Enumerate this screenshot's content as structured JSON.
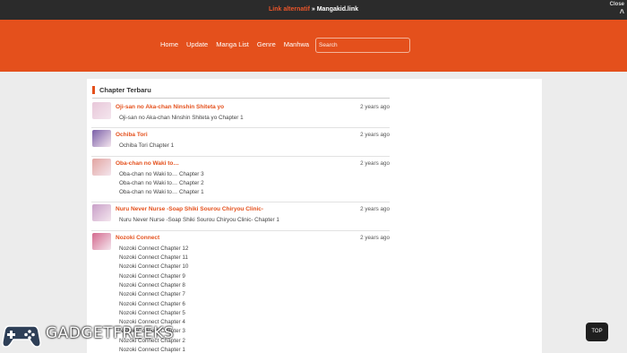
{
  "topbar": {
    "alt_label": "Link alternatif",
    "sep": " » ",
    "site": "Mangakid.link",
    "close_label": "Close",
    "close_icon": "chevron-up-icon"
  },
  "nav": [
    "Home",
    "Update",
    "Manga List",
    "Genre",
    "Manhwa"
  ],
  "search": {
    "placeholder": "Search"
  },
  "section": {
    "title": "Chapter Terbaru"
  },
  "colors": {
    "accent": "#e4501c",
    "topbar": "#2b2b2b",
    "background": "#ececec"
  },
  "items": [
    {
      "title": "Oji-san no Aka-chan Ninshin Shiteta yo",
      "time": "2 years ago",
      "chapters": [
        "Oji-san no Aka-chan Ninshin Shiteta yo Chapter 1"
      ]
    },
    {
      "title": "Ochiba Tori",
      "time": "2 years ago",
      "chapters": [
        "Ochiba Tori Chapter 1"
      ]
    },
    {
      "title": "Oba-chan no Waki to…",
      "time": "2 years ago",
      "chapters": [
        "Oba-chan no Waki to… Chapter 3",
        "Oba-chan no Waki to… Chapter 2",
        "Oba-chan no Waki to… Chapter 1"
      ]
    },
    {
      "title": "Nuru Never Nurse -Soap Shiki Sourou Chiryou Clinic-",
      "time": "2 years ago",
      "chapters": [
        "Nuru Never Nurse -Soap Shiki Sourou Chiryou Clinic- Chapter 1"
      ]
    },
    {
      "title": "Nozoki Connect",
      "time": "2 years ago",
      "chapters": [
        "Nozoki Connect Chapter 12",
        "Nozoki Connect Chapter 11",
        "Nozoki Connect Chapter 10",
        "Nozoki Connect Chapter 9",
        "Nozoki Connect Chapter 8",
        "Nozoki Connect Chapter 7",
        "Nozoki Connect Chapter 6",
        "Nozoki Connect Chapter 5",
        "Nozoki Connect Chapter 4",
        "Nozoki Connect Chapter 3",
        "Nozoki Connect Chapter 2",
        "Nozoki Connect Chapter 1"
      ]
    }
  ],
  "thumb_colors": [
    "#e8c7d9",
    "#7b5fa8",
    "#e2a4a0",
    "#c9a0c8",
    "#d46a8e"
  ],
  "watermark": {
    "text": "GADGETFREEKS",
    "icon": "gamepad-icon"
  },
  "top_button": {
    "label": "TOP"
  }
}
